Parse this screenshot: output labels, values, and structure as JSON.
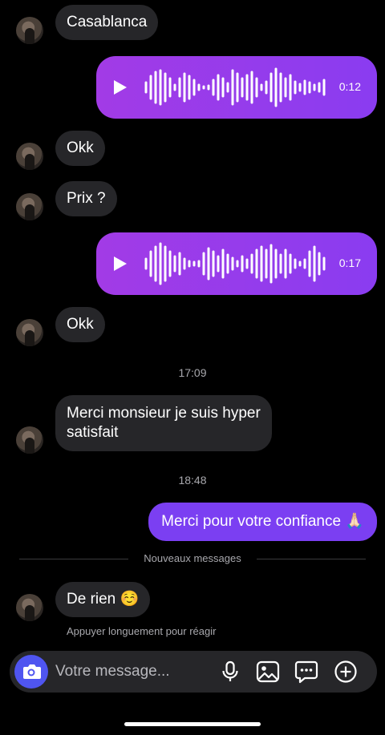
{
  "messages": [
    {
      "text": "Casablanca"
    },
    {
      "duration": "0:12"
    },
    {
      "text": "Okk"
    },
    {
      "text": "Prix ?"
    },
    {
      "duration": "0:17"
    },
    {
      "text": "Okk"
    },
    {
      "time": "17:09"
    },
    {
      "text": "Merci monsieur je suis hyper\nsatisfait"
    },
    {
      "time": "18:48"
    },
    {
      "text": "Merci pour votre confiance 🙏🏻"
    },
    {
      "text": "De rien ☺️"
    }
  ],
  "divider": {
    "label": "Nouveaux messages"
  },
  "reaction_hint": "Appuyer longuement pour réagir",
  "composer": {
    "placeholder": "Votre message..."
  },
  "colors": {
    "accent": "#7b3ff2",
    "background": "#000000",
    "incoming_bubble": "#262629",
    "camera_button": "#4f55f0"
  },
  "icons": [
    "camera-icon",
    "microphone-icon",
    "image-icon",
    "sticker-icon",
    "plus-icon",
    "play-icon"
  ]
}
